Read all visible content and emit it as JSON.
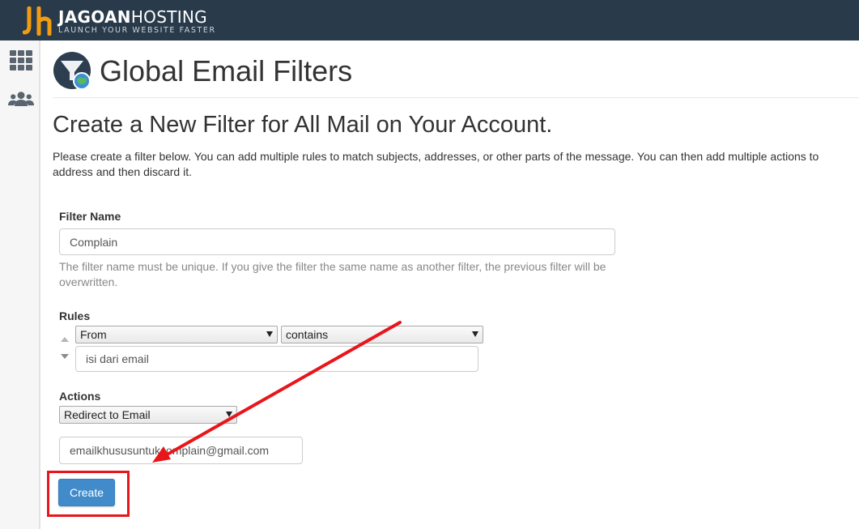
{
  "brand": {
    "name_bold": "JAGOAN",
    "name_regular": "HOSTING",
    "tagline": "LAUNCH YOUR WEBSITE FASTER",
    "colors": {
      "topbar": "#293a4a",
      "logo_orange": "#f39c12",
      "primary": "#428bca",
      "annotation": "#e8161b"
    }
  },
  "sidebar": {
    "items": [
      {
        "icon": "apps-grid-icon"
      },
      {
        "icon": "users-icon"
      }
    ]
  },
  "page": {
    "title": "Global Email Filters",
    "icon": "global-filter-icon",
    "subtitle": "Create a New Filter for All Mail on Your Account.",
    "description": "Please create a filter below. You can add multiple rules to match subjects, addresses, or other parts of the message. You can then add multiple actions to address and then discard it."
  },
  "form": {
    "filter_name": {
      "label": "Filter Name",
      "value": "Complain",
      "help": "The filter name must be unique. If you give the filter the same name as another filter, the previous filter will be overwritten."
    },
    "rules": {
      "label": "Rules",
      "field_select": "From",
      "operator_select": "contains",
      "value": "isi dari email"
    },
    "actions": {
      "label": "Actions",
      "action_select": "Redirect to Email",
      "destination": "emailkhususuntukcomplain@gmail.com"
    },
    "create_label": "Create"
  }
}
